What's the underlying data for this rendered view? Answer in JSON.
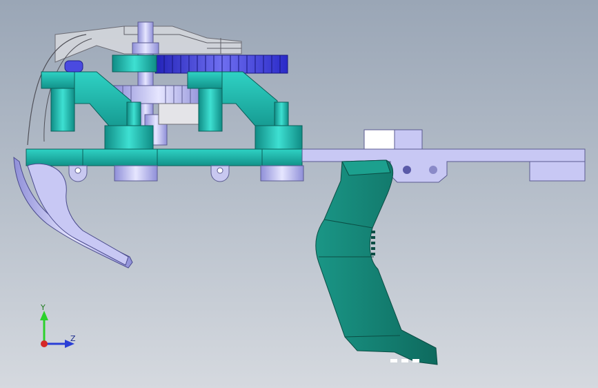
{
  "viewport": {
    "background_top": "#9aa6b6",
    "background_bottom": "#d5d9df"
  },
  "colors": {
    "teal": "#1fb5ad",
    "dark_green": "#137a6c",
    "lavender": "#b8b8ee",
    "light_gray": "#d8d8d8",
    "blue_gear": "#3a3ad6"
  },
  "triad": {
    "y_label": "Y",
    "z_label": "Z",
    "y_color": "#2bd12b",
    "z_color": "#2a3fd6",
    "x_color": "#d62828"
  },
  "icons": [
    "triad-icon"
  ]
}
